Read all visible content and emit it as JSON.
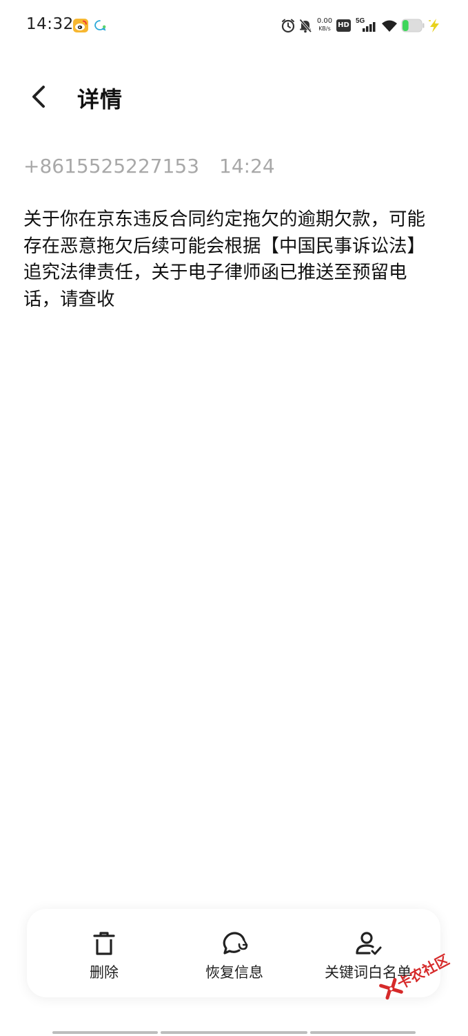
{
  "status_bar": {
    "time": "14:32",
    "net_speed_value": "0.00",
    "net_speed_unit": "KB/s",
    "hd_label": "HD",
    "signal_label": "5G",
    "icons": [
      "weibo-icon",
      "message-notification-icon",
      "alarm-icon",
      "mute-icon",
      "hd-icon",
      "signal-icon",
      "wifi-icon",
      "battery-icon",
      "charging-icon"
    ]
  },
  "header": {
    "title": "详情",
    "back_icon": "chevron-left-icon"
  },
  "message": {
    "sender": "+8615525227153",
    "time": "14:24",
    "body": "关于你在京东违反合同约定拖欠的逾期欠款，可能存在恶意拖欠后续可能会根据【中国民事诉讼法】追究法律责任，关于电子律师函已推送至预留电话，请查收"
  },
  "actions": [
    {
      "label": "删除",
      "icon": "trash-icon"
    },
    {
      "label": "恢复信息",
      "icon": "restore-message-icon"
    },
    {
      "label": "关键词白名单",
      "icon": "keyword-whitelist-icon"
    }
  ],
  "watermark": {
    "text": "卡农社区",
    "icon": "kanong-logo-icon"
  },
  "colors": {
    "title_text": "#111111",
    "meta_text": "#a8a8a8",
    "body_text": "#111111",
    "battery_fill": "#3dd65a",
    "charge_bolt": "#e8d21e",
    "watermark": "#d62a2a"
  },
  "battery_level_fraction": 0.32
}
